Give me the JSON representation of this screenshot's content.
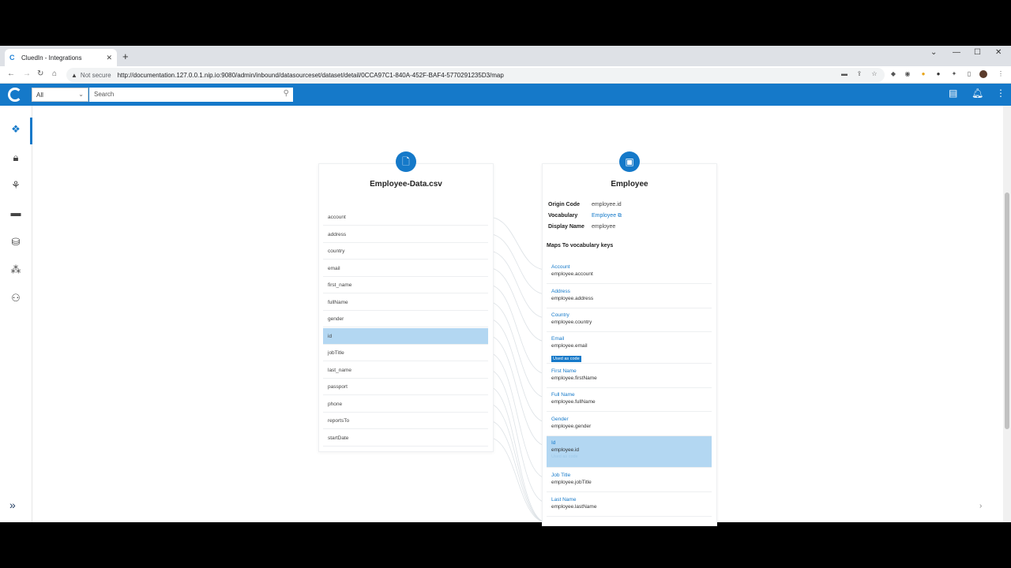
{
  "browser": {
    "tab_title": "CluedIn - Integrations",
    "not_secure": "Not secure",
    "url": "http://documentation.127.0.0.1.nip.io:9080/admin/inbound/datasourceset/dataset/detail/0CCA97C1-840A-452F-BAF4-5770291235D3/map"
  },
  "header": {
    "scope_value": "All",
    "search_placeholder": "Search"
  },
  "source": {
    "title": "Employee-Data.csv",
    "columns": [
      "account",
      "address",
      "country",
      "email",
      "first_name",
      "fullName",
      "gender",
      "id",
      "jobTitle",
      "last_name",
      "passport",
      "phone",
      "reportsTo",
      "startDate"
    ],
    "selected_index": 7
  },
  "entity": {
    "title": "Employee",
    "origin_code_label": "Origin Code",
    "origin_code_value": "employee.id",
    "vocabulary_label": "Vocabulary",
    "vocabulary_value": "Employee",
    "display_name_label": "Display Name",
    "display_name_value": "employee",
    "maps_header": "Maps To vocabulary keys",
    "keys": [
      {
        "name": "Account",
        "key": "employee.account"
      },
      {
        "name": "Address",
        "key": "employee.address"
      },
      {
        "name": "Country",
        "key": "employee.country"
      },
      {
        "name": "Email",
        "key": "employee.email",
        "badge": "Used as code"
      },
      {
        "name": "First Name",
        "key": "employee.firstName"
      },
      {
        "name": "Full Name",
        "key": "employee.fullName"
      },
      {
        "name": "Gender",
        "key": "employee.gender"
      },
      {
        "name": "Id",
        "key": "employee.id",
        "faded": "Used as code",
        "selected": true
      },
      {
        "name": "Job Title",
        "key": "employee.jobTitle"
      },
      {
        "name": "Last Name",
        "key": "employee.lastName"
      }
    ]
  },
  "colors": {
    "brand": "#1579c9",
    "selected_row": "#b3d7f2"
  }
}
